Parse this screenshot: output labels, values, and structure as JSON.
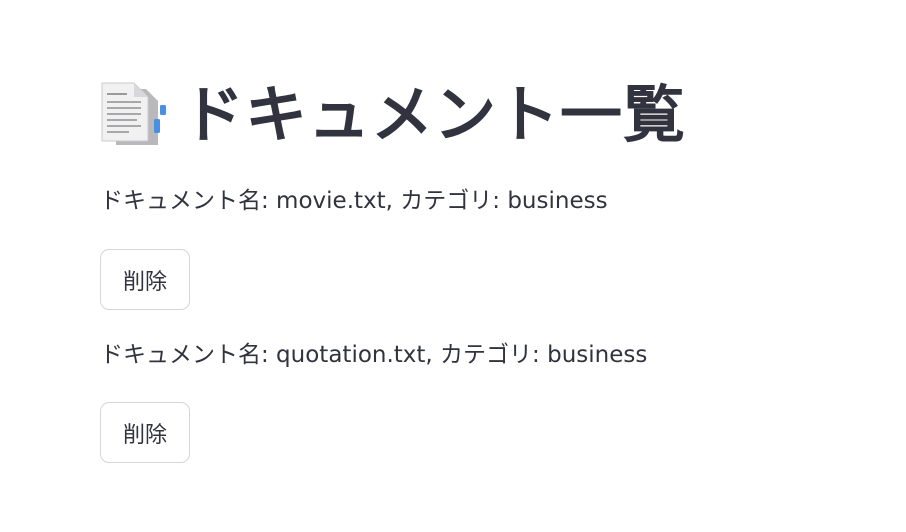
{
  "header": {
    "icon": "document-icon",
    "title": "ドキュメント一覧"
  },
  "documents": [
    {
      "text": "ドキュメント名: movie.txt, カテゴリ: business",
      "delete_label": "削除"
    },
    {
      "text": "ドキュメント名: quotation.txt, カテゴリ: business",
      "delete_label": "削除"
    }
  ]
}
